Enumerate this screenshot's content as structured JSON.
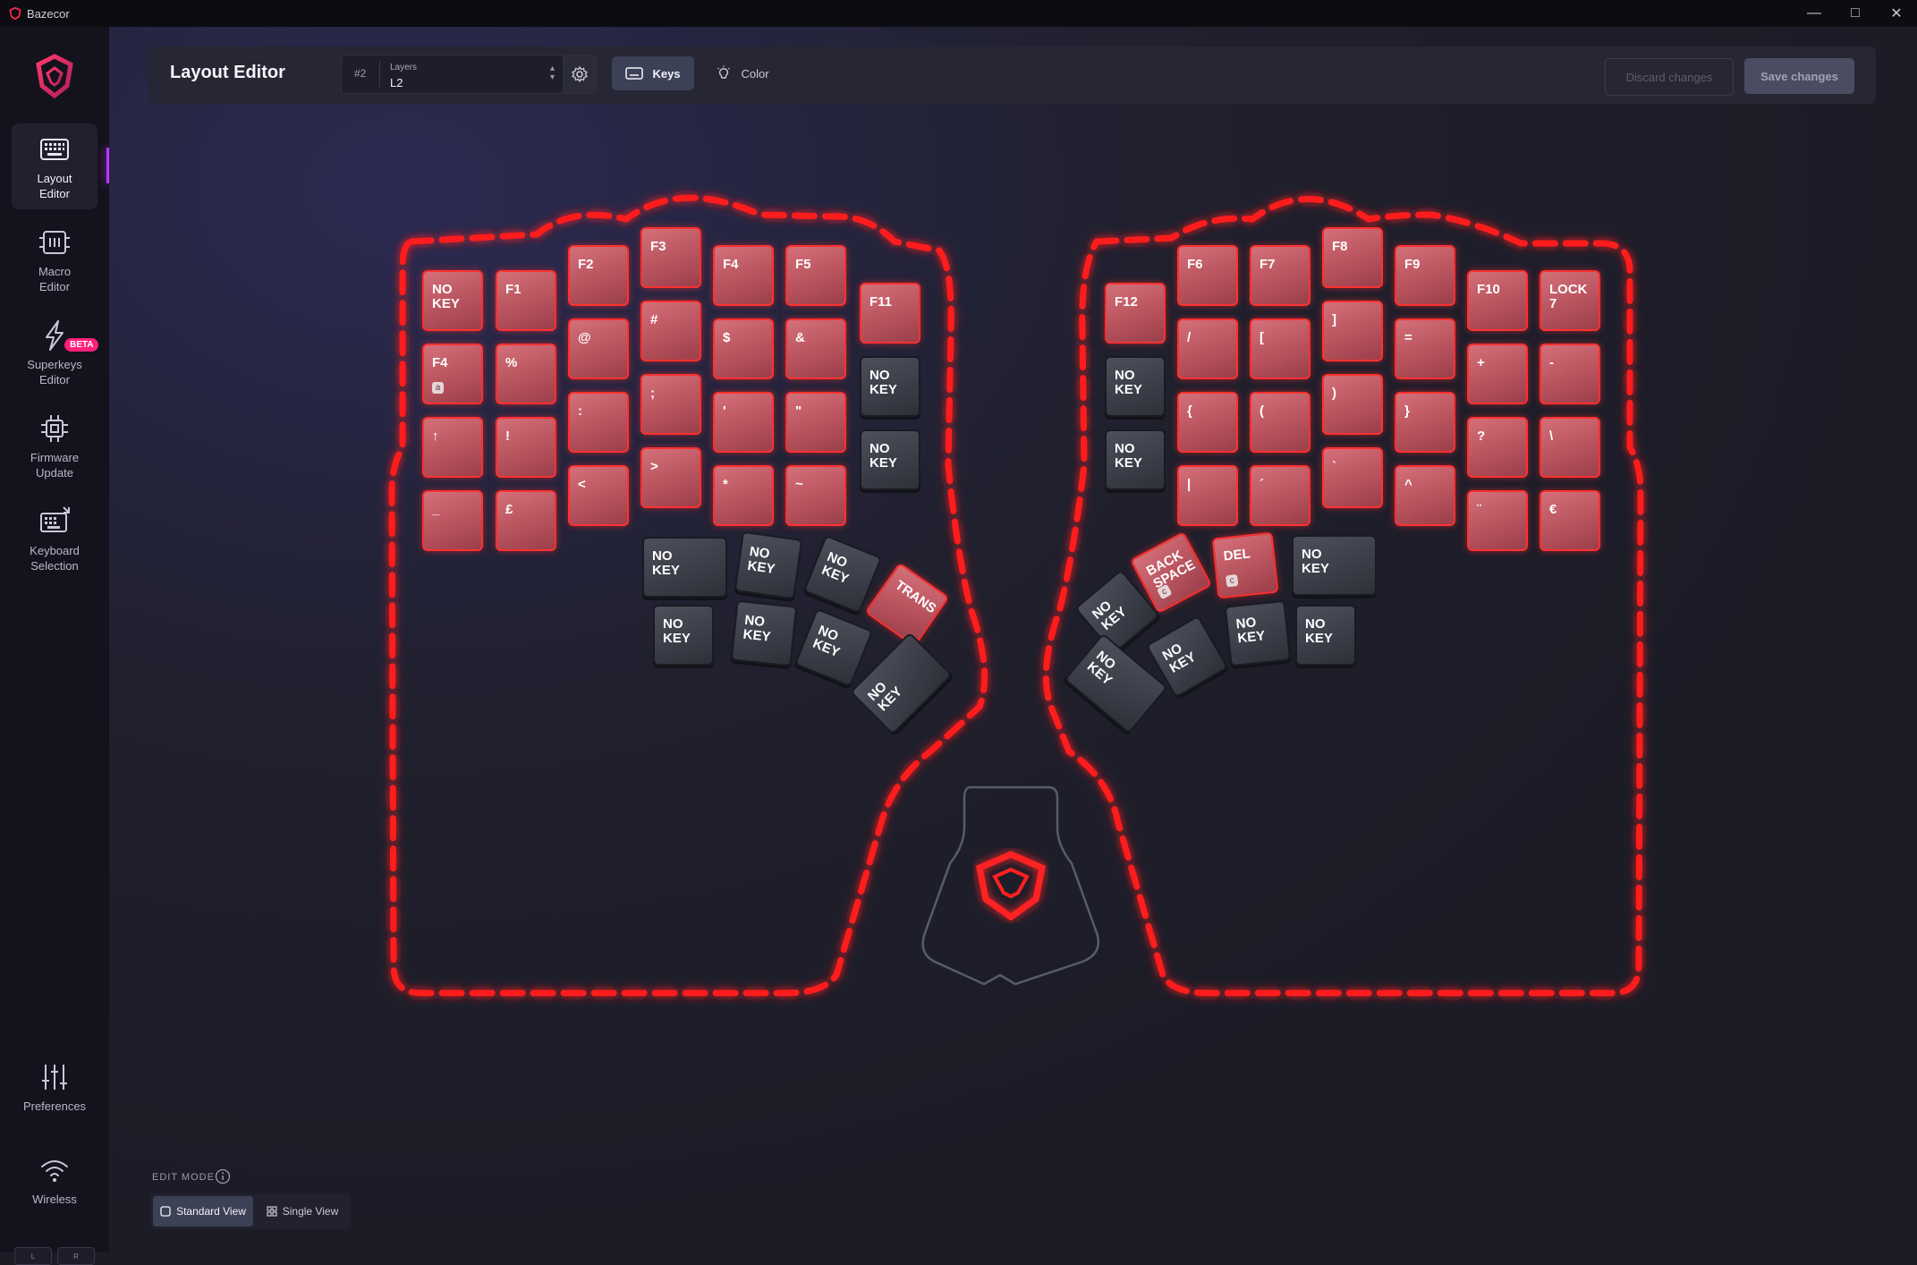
{
  "window": {
    "title": "Bazecor",
    "minimize": "—",
    "maximize": "□",
    "close": "✕"
  },
  "sidebar": {
    "items": [
      {
        "label": "Layout\nEditor",
        "icon": "keyboard-icon",
        "active": true
      },
      {
        "label": "Macro\nEditor",
        "icon": "macro-icon"
      },
      {
        "label": "Superkeys\nEditor",
        "icon": "lightning-icon",
        "badge": "BETA"
      },
      {
        "label": "Firmware\nUpdate",
        "icon": "chip-icon"
      },
      {
        "label": "Keyboard\nSelection",
        "icon": "keyboard-select-icon"
      }
    ],
    "bottom": [
      {
        "label": "Preferences",
        "icon": "sliders-icon"
      },
      {
        "label": "Wireless",
        "icon": "wifi-icon"
      }
    ],
    "battery": {
      "left": "L",
      "right": "R"
    }
  },
  "header": {
    "title": "Layout Editor",
    "layer_number": "#2",
    "layer_caption": "Layers",
    "layer_value": "L2",
    "mode_keys": "Keys",
    "mode_color": "Color",
    "discard": "Discard changes",
    "save": "Save changes"
  },
  "footer": {
    "edit_mode": "EDIT MODE",
    "standard_view": "Standard View",
    "single_view": "Single View"
  },
  "keyboard": {
    "accent_color": "#ff2020",
    "keys": [
      {
        "label": "NO\nKEY",
        "lit": true
      },
      {
        "label": "F1",
        "lit": true
      },
      {
        "label": "F2",
        "lit": true
      },
      {
        "label": "F3",
        "lit": true
      },
      {
        "label": "F4",
        "lit": true
      },
      {
        "label": "F5",
        "lit": true
      },
      {
        "label": "F11",
        "lit": true
      },
      {
        "label": "F4",
        "badge": "a",
        "lit": true
      },
      {
        "label": "%",
        "lit": true
      },
      {
        "label": "@",
        "lit": true
      },
      {
        "label": "#",
        "lit": true
      },
      {
        "label": "$",
        "lit": true
      },
      {
        "label": "&",
        "lit": true
      },
      {
        "label": "NO\nKEY",
        "lit": false
      },
      {
        "label": "↑",
        "lit": true
      },
      {
        "label": "!",
        "lit": true
      },
      {
        "label": ":",
        "lit": true
      },
      {
        "label": ";",
        "lit": true
      },
      {
        "label": "'",
        "lit": true
      },
      {
        "label": "\"",
        "lit": true
      },
      {
        "label": "NO\nKEY",
        "lit": false
      },
      {
        "label": "_",
        "lit": true
      },
      {
        "label": "£",
        "lit": true
      },
      {
        "label": "<",
        "lit": true
      },
      {
        "label": ">",
        "lit": true
      },
      {
        "label": "*",
        "lit": true
      },
      {
        "label": "~",
        "lit": true
      },
      {
        "label": "NO\nKEY",
        "lit": false
      },
      {
        "label": "NO\nKEY",
        "lit": false
      },
      {
        "label": "NO\nKEY",
        "lit": false
      },
      {
        "label": "TRANS",
        "lit": true
      },
      {
        "label": "NO\nKEY",
        "lit": false
      },
      {
        "label": "NO\nKEY",
        "lit": false
      },
      {
        "label": "NO\nKEY",
        "lit": false
      },
      {
        "label": "NO\nKEY",
        "lit": false
      },
      {
        "label": "F12",
        "lit": true
      },
      {
        "label": "F6",
        "lit": true
      },
      {
        "label": "F7",
        "lit": true
      },
      {
        "label": "F8",
        "lit": true
      },
      {
        "label": "F9",
        "lit": true
      },
      {
        "label": "F10",
        "lit": true
      },
      {
        "label": "LOCK\n7",
        "lit": true
      },
      {
        "label": "NO\nKEY",
        "lit": false
      },
      {
        "label": "/",
        "lit": true
      },
      {
        "label": "[",
        "lit": true
      },
      {
        "label": "]",
        "lit": true
      },
      {
        "label": "=",
        "lit": true
      },
      {
        "label": "+",
        "lit": true
      },
      {
        "label": "-",
        "lit": true
      },
      {
        "label": "NO\nKEY",
        "lit": false
      },
      {
        "label": "{",
        "lit": true
      },
      {
        "label": "(",
        "lit": true
      },
      {
        "label": ")",
        "lit": true
      },
      {
        "label": "}",
        "lit": true
      },
      {
        "label": "?",
        "lit": true
      },
      {
        "label": "\\",
        "lit": true
      },
      {
        "label": "|",
        "lit": true
      },
      {
        "label": "´",
        "lit": true
      },
      {
        "label": "`",
        "lit": true
      },
      {
        "label": "^",
        "lit": true
      },
      {
        "label": "¨",
        "lit": true
      },
      {
        "label": "€",
        "lit": true
      },
      {
        "label": "BACK\nSPACE",
        "badge": "c",
        "lit": true
      },
      {
        "label": "DEL",
        "badge": "c",
        "lit": true
      },
      {
        "label": "NO\nKEY",
        "lit": false
      },
      {
        "label": "NO\nKEY",
        "lit": false
      },
      {
        "label": "NO\nKEY",
        "lit": false
      },
      {
        "label": "NO\nKEY",
        "lit": false
      },
      {
        "label": "NO\nKEY",
        "lit": false
      },
      {
        "label": "NO\nKEY",
        "lit": false
      }
    ]
  }
}
